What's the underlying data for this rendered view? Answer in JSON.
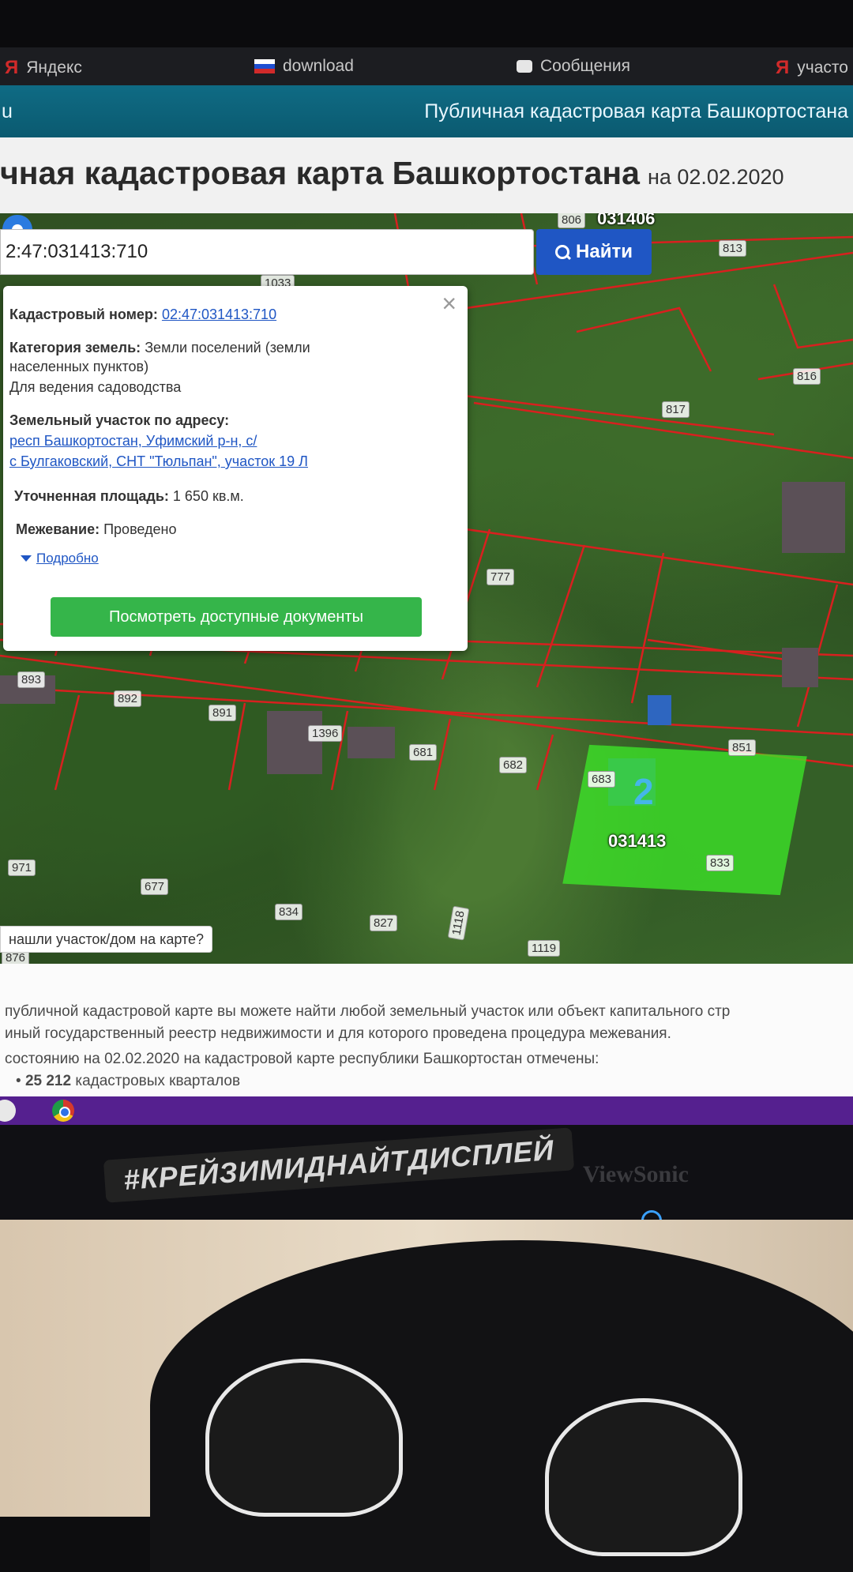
{
  "bookmarks": [
    {
      "icon": "yandex-icon",
      "label": "Яндекс"
    },
    {
      "icon": "flag-icon",
      "label": "download"
    },
    {
      "icon": "message-icon",
      "label": "Сообщения"
    },
    {
      "icon": "yandex-icon",
      "label": "участо"
    }
  ],
  "site": {
    "left_text": "u",
    "name": "Публичная кадастровая карта Башкортостана"
  },
  "page": {
    "title": "чная кадастровая карта Башкортостана",
    "date": "на 02.02.2020"
  },
  "search": {
    "value": "2:47:031413:710",
    "button_label": "Найти"
  },
  "popup": {
    "cadastral_label": "Кадастровый номер:",
    "cadastral_value": "02:47:031413:710",
    "category_label": "Категория земель:",
    "category_value": "Земли поселений (земли",
    "category_value2": "населенных пунктов)",
    "usage": "Для ведения садоводства",
    "address_label": "Земельный участок по адресу:",
    "address_line1": "респ Башкортостан, Уфимский р-н, с/",
    "address_line2": "с Булгаковский, СНТ \"Тюльпан\", участок 19 Л",
    "area_label": "Уточненная площадь:",
    "area_value": "1 650 кв.м.",
    "survey_label": "Межевание:",
    "survey_value": "Проведено",
    "more_link": "Подробно",
    "docs_button": "Посмотреть доступные документы",
    "close": "×"
  },
  "map": {
    "quarters": [
      "031406",
      "031413"
    ],
    "plot_labels": [
      "806",
      "813",
      "1033",
      "816",
      "817",
      "777",
      "893",
      "892",
      "891",
      "1396",
      "681",
      "682",
      "683",
      "851",
      "971",
      "677",
      "834",
      "827",
      "1118",
      "1119",
      "833",
      "876"
    ],
    "selected_plot_number": "2",
    "found_prompt": "нашли участок/дом на карте?"
  },
  "info": {
    "line1": "публичной кадастровой карте вы можете найти любой земельный участок или объект капитального стр",
    "line2": "иный государственный реестр недвижимости и для которого проведена процедура межевания.",
    "line3": "состоянию на 02.02.2020 на кадастровой карте республики Башкортостан отмечены:",
    "bullet_number": "25 212",
    "bullet_text": "кадастровых кварталов"
  },
  "monitor": {
    "sticker": "#КРЕЙЗИМИДНАЙТДИСПЛЕЙ",
    "brand": "ViewSonic"
  },
  "colors": {
    "site_header": "#0f6b84",
    "search_button": "#1f56c4",
    "docs_button": "#35b54a",
    "selected_plot": "#3ce628",
    "taskbar": "#55208f"
  }
}
